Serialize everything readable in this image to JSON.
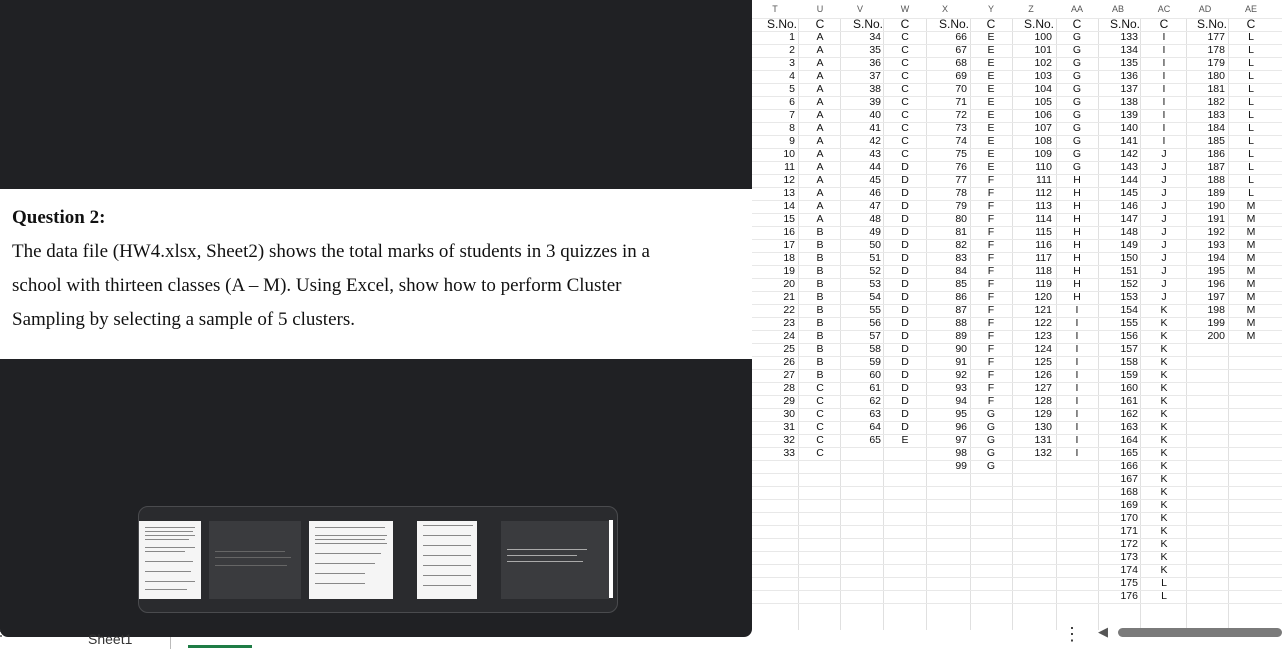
{
  "question": {
    "title": "Question 2:",
    "lines": [
      "The data file (HW4.xlsx, Sheet2) shows the total marks of students in 3 quizzes in a",
      "school with thirteen classes (A – M). Using Excel, show how to perform Cluster",
      "Sampling by selecting a sample of 5 clusters."
    ]
  },
  "sheet_tab": {
    "label": "Sheet1"
  },
  "columns": [
    "T",
    "U",
    "V",
    "W",
    "X",
    "Y",
    "Z",
    "AA",
    "AB",
    "AC",
    "AD",
    "AE"
  ],
  "header_labels": {
    "sno": "S.No.",
    "cls": "C"
  },
  "blocks": [
    {
      "sno_start": 1,
      "classes": [
        "A",
        "A",
        "A",
        "A",
        "A",
        "A",
        "A",
        "A",
        "A",
        "A",
        "A",
        "A",
        "A",
        "A",
        "A",
        "B",
        "B",
        "B",
        "B",
        "B",
        "B",
        "B",
        "B",
        "B",
        "B",
        "B",
        "B",
        "C",
        "C",
        "C",
        "C",
        "C",
        "C"
      ]
    },
    {
      "sno_start": 34,
      "classes": [
        "C",
        "C",
        "C",
        "C",
        "C",
        "C",
        "C",
        "C",
        "C",
        "C",
        "D",
        "D",
        "D",
        "D",
        "D",
        "D",
        "D",
        "D",
        "D",
        "D",
        "D",
        "D",
        "D",
        "D",
        "D",
        "D",
        "D",
        "D",
        "D",
        "D",
        "D",
        "E"
      ]
    },
    {
      "sno_start": 66,
      "classes": [
        "E",
        "E",
        "E",
        "E",
        "E",
        "E",
        "E",
        "E",
        "E",
        "E",
        "E",
        "F",
        "F",
        "F",
        "F",
        "F",
        "F",
        "F",
        "F",
        "F",
        "F",
        "F",
        "F",
        "F",
        "F",
        "F",
        "F",
        "F",
        "F",
        "G",
        "G",
        "G",
        "G",
        "G"
      ]
    },
    {
      "sno_start": 100,
      "classes": [
        "G",
        "G",
        "G",
        "G",
        "G",
        "G",
        "G",
        "G",
        "G",
        "G",
        "G",
        "H",
        "H",
        "H",
        "H",
        "H",
        "H",
        "H",
        "H",
        "H",
        "H",
        "I",
        "I",
        "I",
        "I",
        "I",
        "I",
        "I",
        "I",
        "I",
        "I",
        "I",
        "I"
      ]
    },
    {
      "sno_start": 133,
      "classes": [
        "I",
        "I",
        "I",
        "I",
        "I",
        "I",
        "I",
        "I",
        "I",
        "J",
        "J",
        "J",
        "J",
        "J",
        "J",
        "J",
        "J",
        "J",
        "J",
        "J",
        "J",
        "K",
        "K",
        "K",
        "K",
        "K",
        "K",
        "K",
        "K",
        "K",
        "K",
        "K",
        "K",
        "K",
        "K",
        "K",
        "K",
        "K",
        "K",
        "K",
        "K",
        "K",
        "L",
        "L"
      ]
    },
    {
      "sno_start": 177,
      "classes": [
        "L",
        "L",
        "L",
        "L",
        "L",
        "L",
        "L",
        "L",
        "L",
        "L",
        "L",
        "L",
        "L",
        "M",
        "M",
        "M",
        "M",
        "M",
        "M",
        "M",
        "M",
        "M",
        "M",
        "M"
      ]
    }
  ],
  "block_lengths": [
    33,
    32,
    34,
    33,
    44,
    24
  ]
}
